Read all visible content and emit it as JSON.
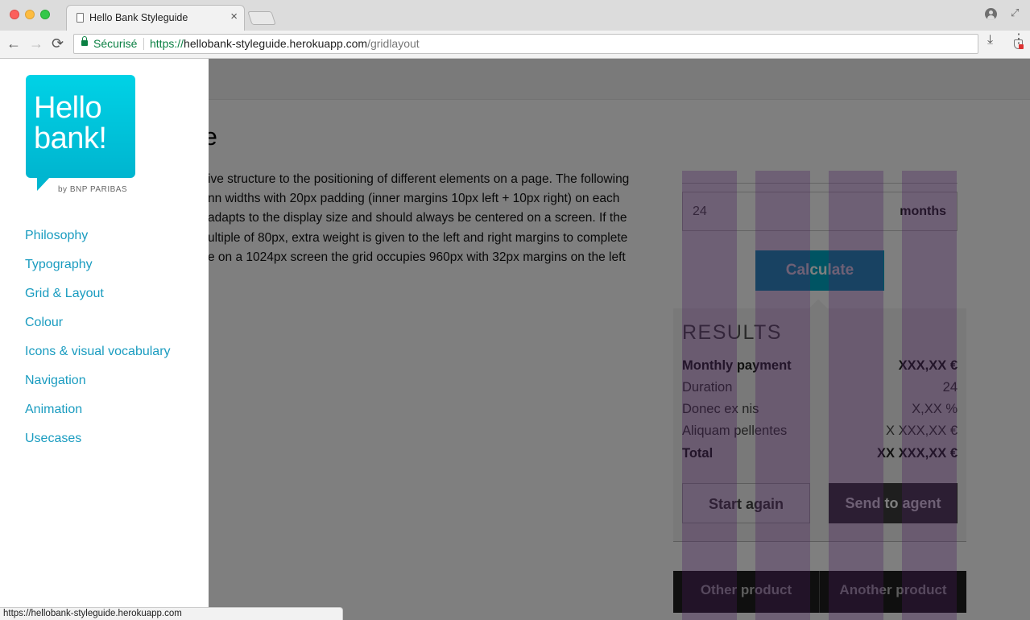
{
  "browser": {
    "tab_title": "Hello Bank Styleguide",
    "tab_close": "×",
    "secure_label": "Sécurisé",
    "url_protocol": "https://",
    "url_host": "hellobank-styleguide.herokuapp.com",
    "url_path": "/gridlayout",
    "back_glyph": "←",
    "forward_glyph": "→",
    "reload_glyph": "⟳",
    "star_glyph": "☆",
    "download_glyph": "⤓",
    "menu_glyph": "⋮",
    "fullscreen_glyph": "⤢"
  },
  "sidebar": {
    "logo": {
      "line1": "Hello",
      "line2": "bank!",
      "sub": "by BNP PARIBAS"
    },
    "items": [
      {
        "label": "Philosophy"
      },
      {
        "label": "Typography"
      },
      {
        "label": "Grid & Layout"
      },
      {
        "label": "Colour"
      },
      {
        "label": "Icons & visual vocabulary"
      },
      {
        "label": "Navigation"
      },
      {
        "label": "Animation"
      },
      {
        "label": "Usecases"
      }
    ]
  },
  "main": {
    "heading_fragment": "ure",
    "body_lines": [
      "ive structure to the positioning of different elements on a page. The following",
      "nn widths with 20px padding (inner margins 10px left + 10px right) on each",
      "adapts to the display size and should always be centered on a screen. If the",
      "ultiple of 80px, extra weight is given to the left and right margins to complete",
      "e on a 1024px screen the grid occupies 960px with 32px margins on the left"
    ]
  },
  "demo": {
    "input_value": "24",
    "input_unit": "months",
    "calculate_label": "Calculate",
    "results_title": "RESULTS",
    "rows": [
      {
        "label": "Monthly payment",
        "value": "XXX,XX €"
      },
      {
        "label": "Duration",
        "value": "24"
      },
      {
        "label": "Donec ex nis",
        "value": "X,XX %"
      },
      {
        "label": "Aliquam pellentes",
        "value": "X XXX,XX €"
      },
      {
        "label": "Total",
        "value": "XX XXX,XX €"
      }
    ],
    "start_again_label": "Start again",
    "send_agent_label": "Send to agent",
    "other_product_label": "Other product",
    "another_product_label": "Another product"
  },
  "status_url": "https://hellobank-styleguide.herokuapp.com",
  "colors": {
    "accent": "#1a9cc0",
    "brand": "#00c3dc",
    "secure_green": "#0b8043",
    "grid_overlay": "#9a46c0"
  }
}
